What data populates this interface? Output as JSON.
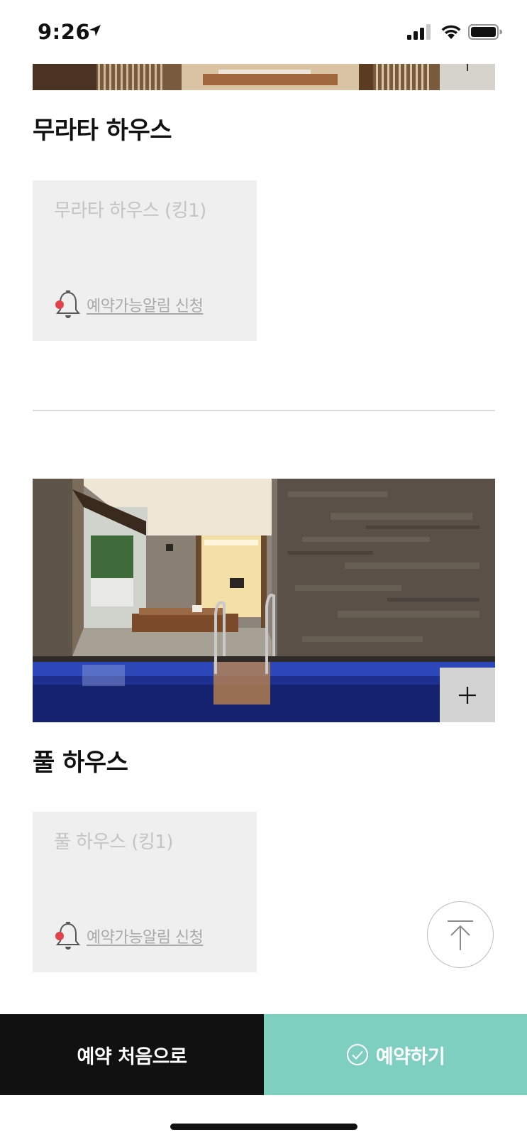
{
  "status_bar": {
    "time": "9:26"
  },
  "sections": [
    {
      "title": "무라타 하우스",
      "rooms": [
        {
          "name": "무라타 하우스 (킹1)",
          "alarm_link": "예약가능알림 신청"
        }
      ]
    },
    {
      "title": "풀 하우스",
      "rooms": [
        {
          "name": "풀 하우스 (킹1)",
          "alarm_link": "예약가능알림 신청"
        }
      ]
    }
  ],
  "bottom_bar": {
    "start_over_label": "예약 처음으로",
    "reserve_label": "예약하기"
  },
  "colors": {
    "reserve_button": "#7ecfc0",
    "start_button": "#111111",
    "alarm_dot": "#e0434a",
    "card_background": "#efefef"
  },
  "icons": {
    "location": "location-arrow-icon",
    "signal": "signal-icon",
    "wifi": "wifi-icon",
    "battery": "battery-icon",
    "bell": "bell-icon",
    "plus": "plus-icon",
    "scroll_top": "arrow-up-icon",
    "check": "check-circle-icon"
  }
}
